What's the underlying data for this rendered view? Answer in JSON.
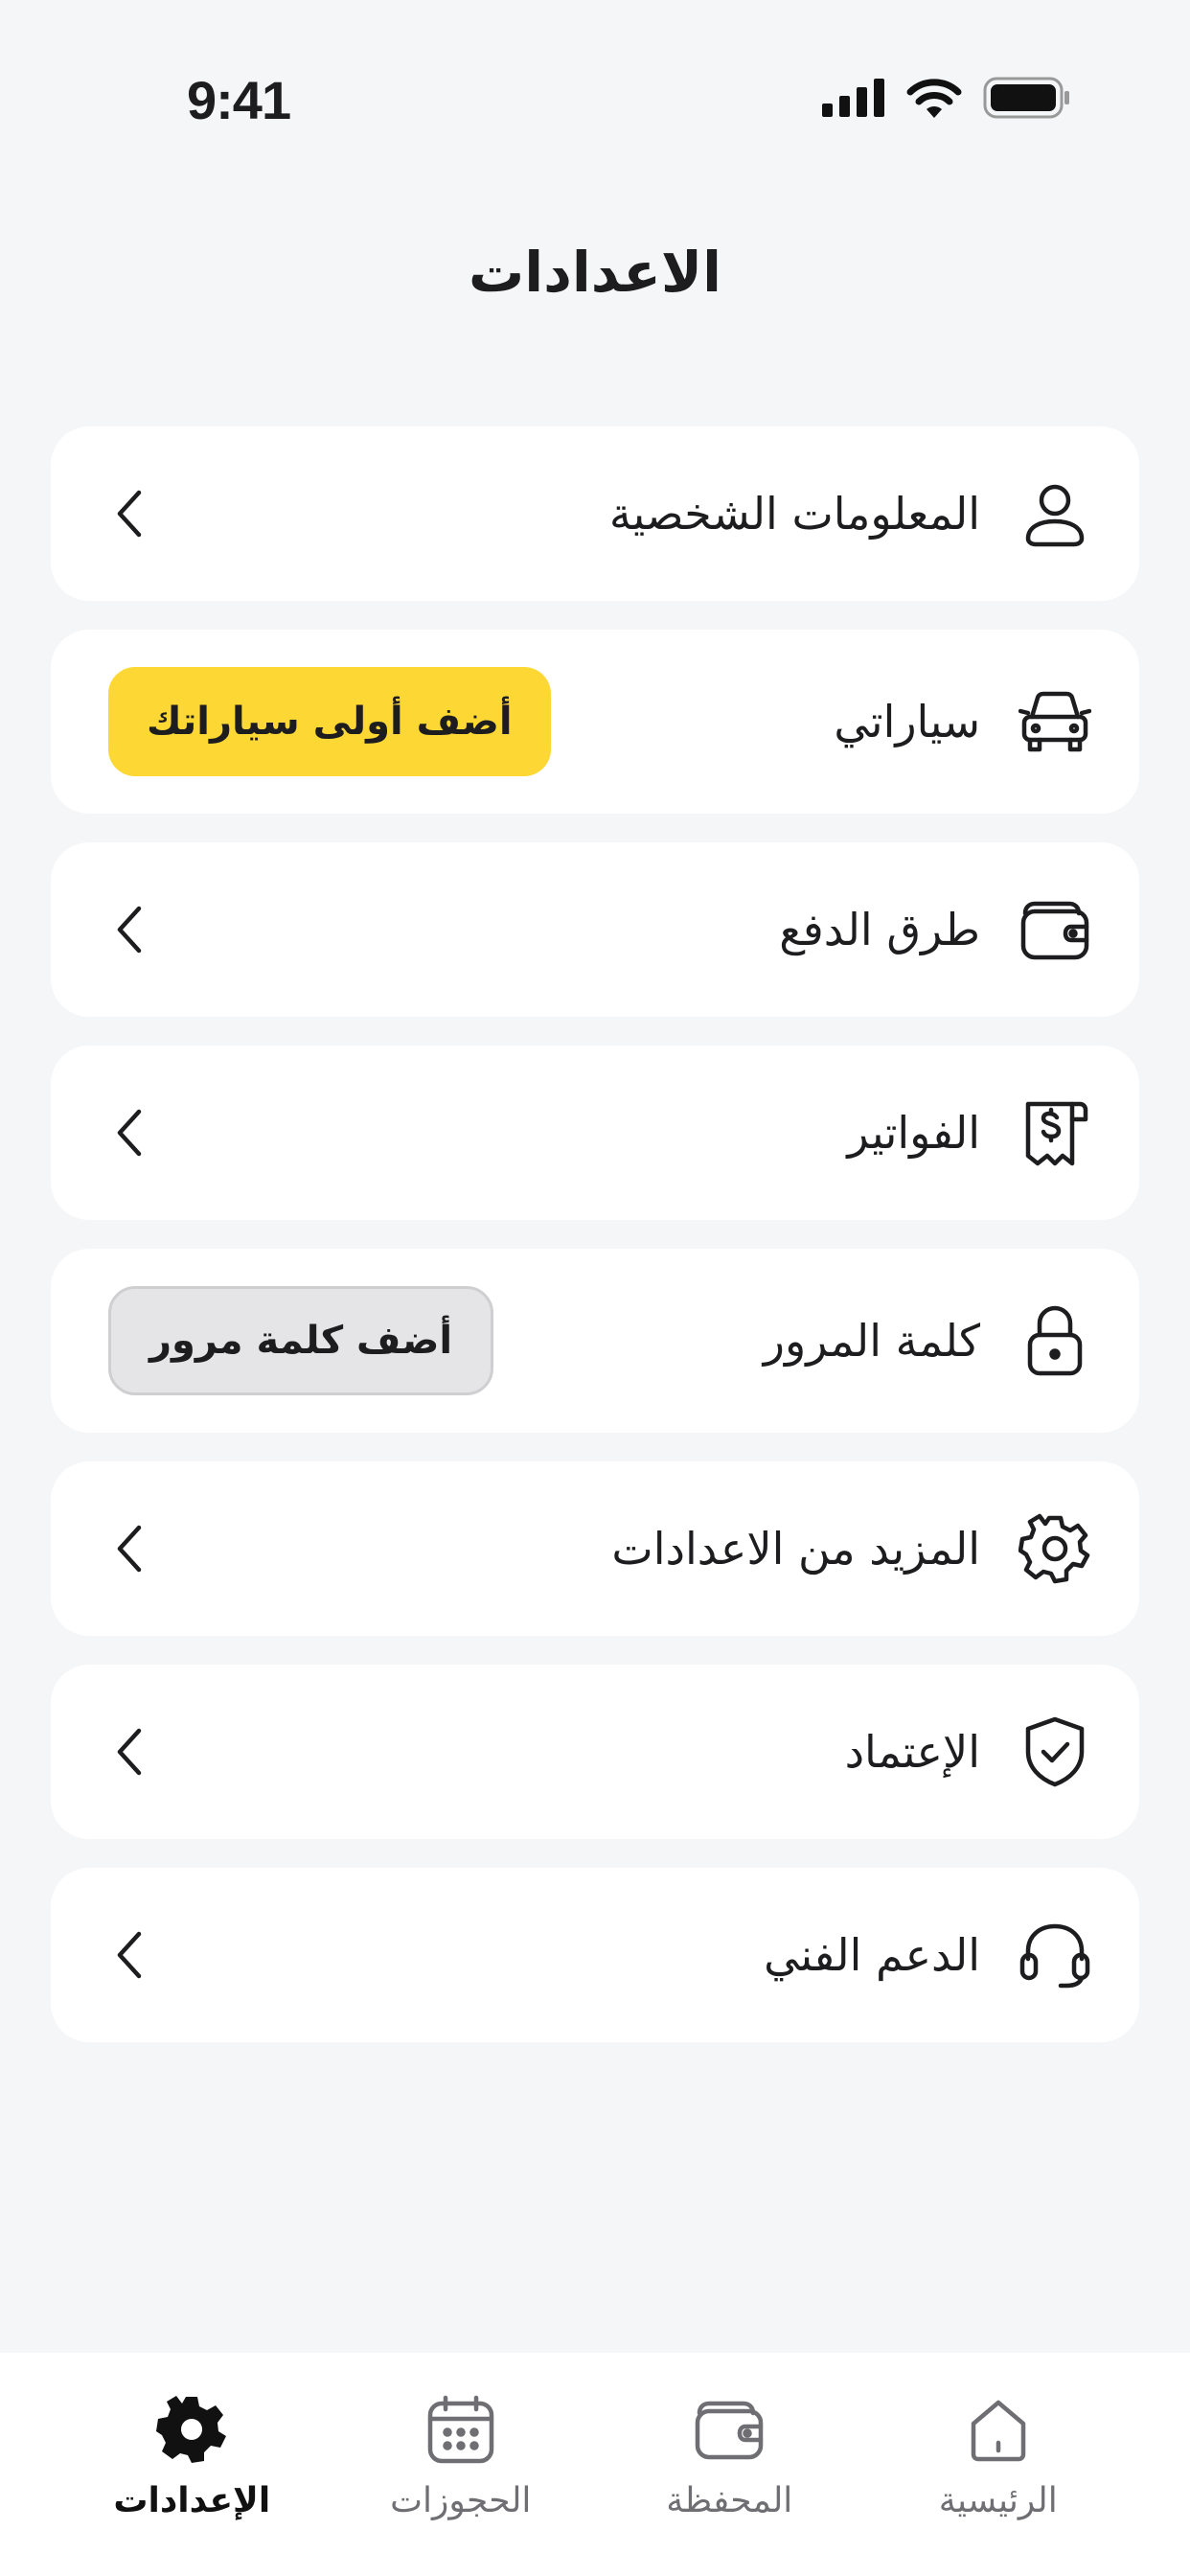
{
  "status_bar": {
    "time": "9:41"
  },
  "header": {
    "title": "الاعدادات"
  },
  "settings": {
    "items": [
      {
        "label": "المعلومات الشخصية",
        "icon": "user-icon"
      },
      {
        "label": "سياراتي",
        "icon": "car-icon",
        "action_label": "أضف أولى سياراتك"
      },
      {
        "label": "طرق الدفع",
        "icon": "wallet-icon"
      },
      {
        "label": "الفواتير",
        "icon": "receipt-icon"
      },
      {
        "label": "كلمة المرور",
        "icon": "lock-icon",
        "action_label": "أضف كلمة مرور"
      },
      {
        "label": "المزيد من الاعدادات",
        "icon": "gear-icon"
      },
      {
        "label": "الإعتماد",
        "icon": "shield-check-icon"
      },
      {
        "label": "الدعم الفني",
        "icon": "headset-icon"
      }
    ]
  },
  "tab_bar": {
    "tabs": [
      {
        "label": "الرئيسية",
        "icon": "home-icon"
      },
      {
        "label": "المحفظة",
        "icon": "wallet-icon"
      },
      {
        "label": "الحجوزات",
        "icon": "calendar-icon"
      },
      {
        "label": "الإعدادات",
        "icon": "gear-icon",
        "active": true
      }
    ]
  },
  "colors": {
    "accent": "#fdd835",
    "background": "#f5f6f8",
    "card": "#ffffff",
    "text": "#1d1d1f"
  }
}
